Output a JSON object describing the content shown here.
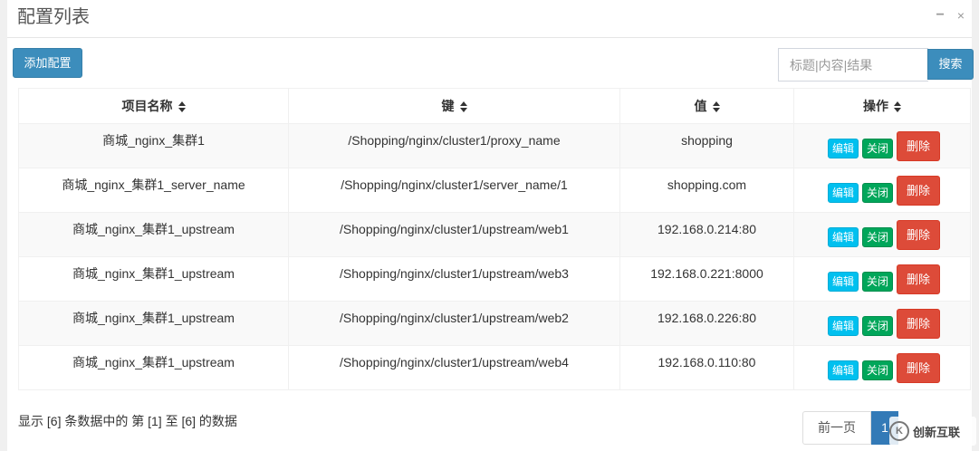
{
  "panel": {
    "title": "配置列表",
    "minimize_icon": "−",
    "close_icon": "×"
  },
  "toolbar": {
    "add_label": "添加配置",
    "search_placeholder": "标题|内容|结果",
    "search_value": "",
    "search_label": "搜索"
  },
  "table": {
    "columns": [
      "项目名称",
      "键",
      "值",
      "操作"
    ],
    "rows": [
      {
        "name": "商城_nginx_集群1",
        "key": "/Shopping/nginx/cluster1/proxy_name",
        "value": "shopping"
      },
      {
        "name": "商城_nginx_集群1_server_name",
        "key": "/Shopping/nginx/cluster1/server_name/1",
        "value": "shopping.com"
      },
      {
        "name": "商城_nginx_集群1_upstream",
        "key": "/Shopping/nginx/cluster1/upstream/web1",
        "value": "192.168.0.214:80"
      },
      {
        "name": "商城_nginx_集群1_upstream",
        "key": "/Shopping/nginx/cluster1/upstream/web3",
        "value": "192.168.0.221:8000"
      },
      {
        "name": "商城_nginx_集群1_upstream",
        "key": "/Shopping/nginx/cluster1/upstream/web2",
        "value": "192.168.0.226:80"
      },
      {
        "name": "商城_nginx_集群1_upstream",
        "key": "/Shopping/nginx/cluster1/upstream/web4",
        "value": "192.168.0.110:80"
      }
    ],
    "actions": {
      "edit": "编辑",
      "close": "关闭",
      "delete": "删除"
    }
  },
  "footer": {
    "info": "显示 [6] 条数据中的 第 [1] 至 [6] 的数据",
    "prev_label": "前一页",
    "current_page": "1"
  },
  "watermark": {
    "icon": "K",
    "text": "创新互联"
  },
  "colors": {
    "primary": "#3c8dbc",
    "info": "#00c0ef",
    "success": "#00a65a",
    "danger": "#dd4b39",
    "page_active": "#337ab7"
  }
}
